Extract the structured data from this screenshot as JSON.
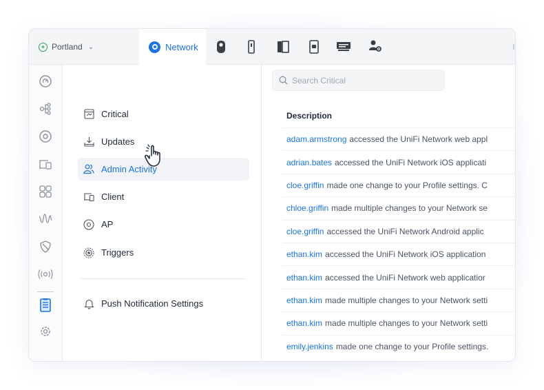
{
  "colors": {
    "accent": "#1a73e8",
    "site_status": "#22a35a",
    "active_row_bg": "#f1f3f6"
  },
  "topbar": {
    "site_name": "Portland",
    "active_tab": "Network",
    "app_icons": [
      "protect-camera-icon",
      "access-reader-icon",
      "talk-panel-icon",
      "intercom-icon",
      "connect-display-icon",
      "admin-users-icon"
    ]
  },
  "rail": {
    "items": [
      "dashboard-icon",
      "topology-icon",
      "devices-icon",
      "clients-icon",
      "statistics-icon",
      "radios-icon",
      "security-shield-icon",
      "wifi-broadcast-icon",
      "system-log-icon",
      "settings-icon"
    ]
  },
  "menu": {
    "items": [
      {
        "label": "Critical",
        "icon": "warning-box-icon"
      },
      {
        "label": "Updates",
        "icon": "download-tray-icon"
      },
      {
        "label": "Admin Activity",
        "icon": "admins-icon",
        "active": true
      },
      {
        "label": "Client",
        "icon": "laptop-icon"
      },
      {
        "label": "AP",
        "icon": "access-point-icon"
      },
      {
        "label": "Triggers",
        "icon": "trigger-target-icon"
      }
    ],
    "push_label": "Push Notification Settings"
  },
  "content": {
    "search_placeholder": "Search Critical",
    "column_header": "Description",
    "rows": [
      {
        "user": "adam.armstrong",
        "text": "accessed the UniFi Network web appl"
      },
      {
        "user": "adrian.bates",
        "text": "accessed the UniFi Network iOS applicati"
      },
      {
        "user": "cloe.griffin",
        "text": "made one change to your Profile settings. C"
      },
      {
        "user": "chloe.griffin",
        "text": "made multiple changes to your Network se"
      },
      {
        "user": "cloe.griffin",
        "text": "accessed the UniFi Network Android applic"
      },
      {
        "user": "ethan.kim",
        "text": "accessed the UniFi Network iOS application"
      },
      {
        "user": "ethan.kim",
        "text": "accessed the UniFi Network web applicatior"
      },
      {
        "user": "ethan.kim",
        "text": "made multiple changes to your Network setti"
      },
      {
        "user": "ethan.kim",
        "text": "made multiple changes to your Network setti"
      },
      {
        "user": "emily.jenkins",
        "text": "made one change to your Profile settings."
      }
    ]
  }
}
